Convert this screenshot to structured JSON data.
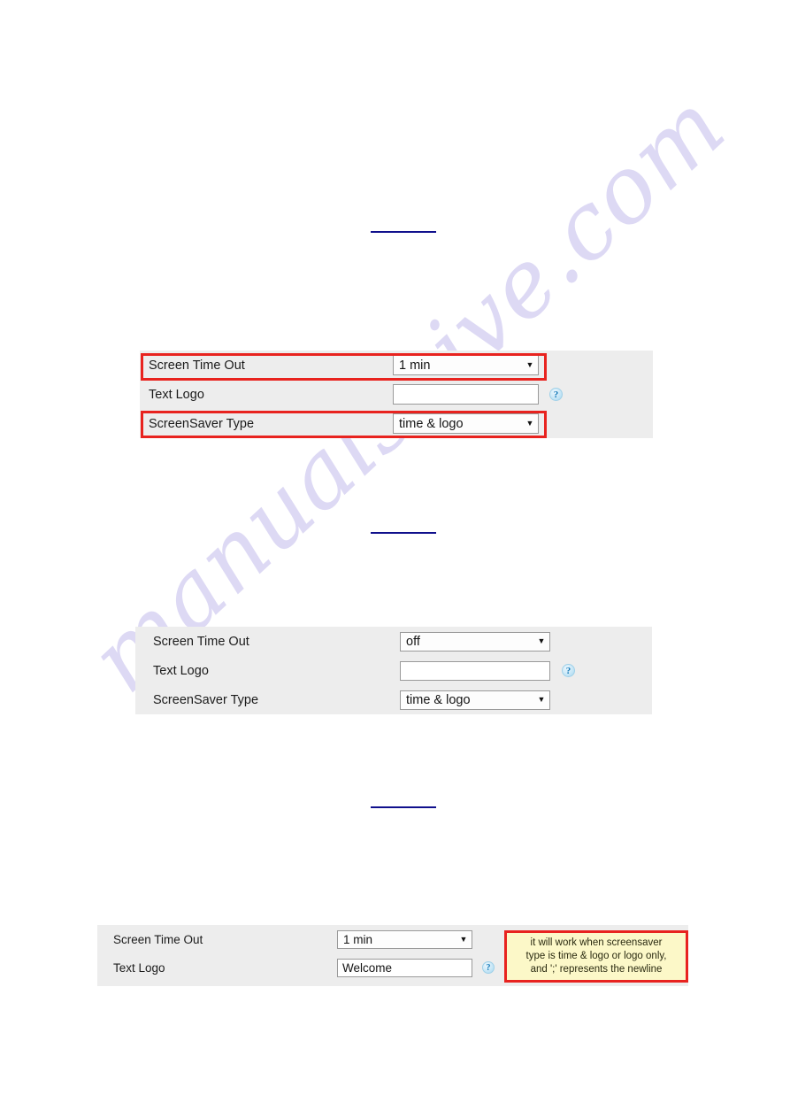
{
  "document": {
    "watermark": "manualshive.com"
  },
  "colors": {
    "highlight_red": "#e8231f",
    "panel_background": "#ededed",
    "tooltip_background": "#fcf8c8",
    "link_blue": "#10108c",
    "help_icon_blue": "#1479b8"
  },
  "labels": {
    "screen_time_out": "Screen Time Out",
    "text_logo": "Text Logo",
    "screensaver_type": "ScreenSaver Type"
  },
  "icons": {
    "help": "?",
    "dropdown_caret": "▼"
  },
  "panels": [
    {
      "id": "panel-1",
      "highlighted_rows": [
        "screen_time_out",
        "screensaver_type"
      ],
      "rows": [
        {
          "label": "Screen Time Out",
          "control": "select",
          "value": "1 min",
          "highlighted": true,
          "help": false
        },
        {
          "label": "Text Logo",
          "control": "textbox",
          "value": "",
          "placeholder": "",
          "highlighted": false,
          "help": true
        },
        {
          "label": "ScreenSaver Type",
          "control": "select",
          "value": "time & logo",
          "highlighted": true,
          "help": false
        }
      ]
    },
    {
      "id": "panel-2",
      "highlighted_rows": [],
      "rows": [
        {
          "label": "Screen Time Out",
          "control": "select",
          "value": "off",
          "highlighted": false,
          "help": false
        },
        {
          "label": "Text Logo",
          "control": "textbox",
          "value": "",
          "placeholder": "",
          "highlighted": false,
          "help": true
        },
        {
          "label": "ScreenSaver Type",
          "control": "select",
          "value": "time & logo",
          "highlighted": false,
          "help": false
        }
      ]
    },
    {
      "id": "panel-3",
      "highlighted_rows": [],
      "rows": [
        {
          "label": "Screen Time Out",
          "control": "select",
          "value": "1 min",
          "highlighted": false,
          "help": false
        },
        {
          "label": "Text Logo",
          "control": "textbox",
          "value": "Welcome",
          "placeholder": "",
          "highlighted": false,
          "help": true
        }
      ]
    }
  ],
  "tooltip": {
    "line1": "it will work when screensaver",
    "line2": "type is time & logo or logo only,",
    "line3": "and ';' represents the newline"
  },
  "select_options": {
    "screen_time_out": [
      "off",
      "1 min"
    ],
    "screensaver_type": [
      "time & logo"
    ]
  }
}
